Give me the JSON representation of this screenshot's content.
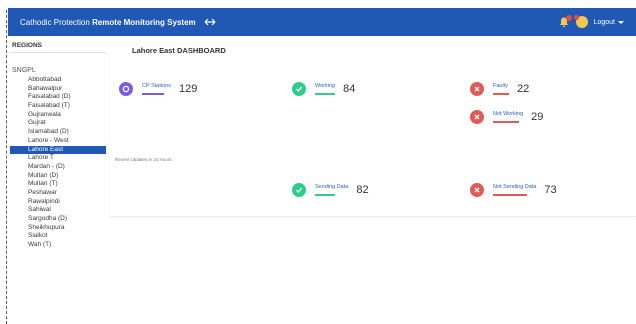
{
  "colors": {
    "topbar": "#1f58b5",
    "purple": "#7a5ce0",
    "green": "#2ecc8f",
    "red": "#e05a5a",
    "link": "#2a62c6",
    "active": "#1f58b5"
  },
  "header": {
    "app_title_light": "Cathodic Protection",
    "app_title_bold": "Remote Monitoring System",
    "menu_icon": "double-arrow-icon",
    "bell_icon": "bell-icon",
    "user_icon": "user-icon",
    "logout_label": "Logout"
  },
  "sidebar": {
    "header": "REGIONS",
    "group": "SNGPL",
    "items": [
      {
        "label": "Abbottabad"
      },
      {
        "label": "Bahawalpur"
      },
      {
        "label": "Faisalabad (D)"
      },
      {
        "label": "Faisalabad (T)"
      },
      {
        "label": "Gujranwala"
      },
      {
        "label": "Gujrat"
      },
      {
        "label": "Islamabad (D)"
      },
      {
        "label": "Lahore - West"
      },
      {
        "label": "Lahore East"
      },
      {
        "label": "Lahore T"
      },
      {
        "label": "Mardan - (D)"
      },
      {
        "label": "Multan (D)"
      },
      {
        "label": "Multan (T)"
      },
      {
        "label": "Peshawar"
      },
      {
        "label": "Rawalpindi"
      },
      {
        "label": "Sahiwal"
      },
      {
        "label": "Sargodha (D)"
      },
      {
        "label": "Sheikhupura"
      },
      {
        "label": "Sialkot"
      },
      {
        "label": "Wah (T)"
      }
    ],
    "active_index": 8
  },
  "main": {
    "title": "Lahore East DASHBOARD",
    "stats": {
      "cp_stations": {
        "label": "CP Stations",
        "value": "129",
        "icon": "circle-dot-icon"
      },
      "working": {
        "label": "Working",
        "value": "84",
        "icon": "check-icon"
      },
      "faulty": {
        "label": "Faulty",
        "value": "22",
        "icon": "close-icon"
      },
      "not_working": {
        "label": "Not Working",
        "value": "29",
        "icon": "close-icon"
      },
      "sending_data": {
        "label": "Sending Data",
        "value": "82",
        "icon": "check-icon"
      },
      "not_sending_data": {
        "label": "Not Sending Data",
        "value": "73",
        "icon": "close-icon"
      }
    },
    "update_note": "Recent Updates in 24 Hours"
  }
}
